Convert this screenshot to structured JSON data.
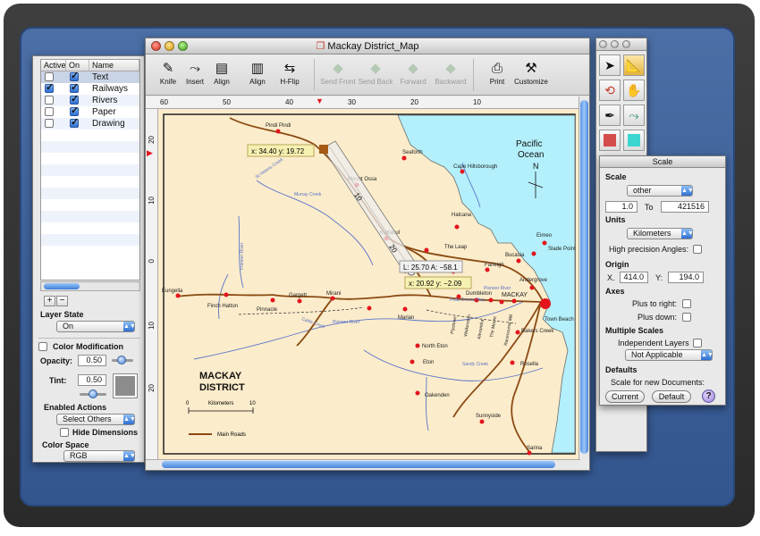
{
  "layers": {
    "columns": [
      "Active",
      "On",
      "Name"
    ],
    "rows": [
      {
        "name": "Text",
        "active": false,
        "on": true
      },
      {
        "name": "Railways",
        "active": true,
        "on": true
      },
      {
        "name": "Rivers",
        "active": false,
        "on": true
      },
      {
        "name": "Paper",
        "active": false,
        "on": true
      },
      {
        "name": "Drawing",
        "active": false,
        "on": true
      }
    ],
    "add_label": "+",
    "remove_label": "−",
    "layer_state_label": "Layer State",
    "layer_state_value": "On",
    "color_mod_label": "Color Modification",
    "opacity_label": "Opacity:",
    "opacity_value": "0.50",
    "tint_label": "Tint:",
    "tint_value": "0.50",
    "enabled_actions_label": "Enabled Actions",
    "enabled_actions_value": "Select Others",
    "hide_dimensions_label": "Hide Dimensions",
    "color_space_label": "Color Space",
    "color_space_value": "RGB"
  },
  "map_window": {
    "title": "Mackay District_Map",
    "toolbar": [
      {
        "label": "Knife",
        "icon": "knife-icon",
        "glyph": "✎",
        "enabled": true
      },
      {
        "label": "Insert",
        "icon": "insert-icon",
        "glyph": "⤳",
        "enabled": true
      },
      {
        "label": "Align",
        "icon": "align-left-icon",
        "glyph": "▤",
        "enabled": true
      },
      {
        "label": "Align",
        "icon": "align-top-icon",
        "glyph": "▥",
        "enabled": true
      },
      {
        "label": "H-Flip",
        "icon": "hflip-icon",
        "glyph": "⇆",
        "enabled": true
      },
      {
        "label": "Send Front",
        "icon": "send-front-icon",
        "glyph": "◆",
        "enabled": false
      },
      {
        "label": "Send Back",
        "icon": "send-back-icon",
        "glyph": "◆",
        "enabled": false
      },
      {
        "label": "Forward",
        "icon": "forward-icon",
        "glyph": "◆",
        "enabled": false
      },
      {
        "label": "Backward",
        "icon": "backward-icon",
        "glyph": "◆",
        "enabled": false
      },
      {
        "label": "Print",
        "icon": "print-icon",
        "glyph": "⎙",
        "enabled": true
      },
      {
        "label": "Customize",
        "icon": "customize-icon",
        "glyph": "⚒",
        "enabled": true
      }
    ],
    "hruler_ticks": [
      "60",
      "50",
      "40",
      "30",
      "20",
      "10"
    ],
    "vruler_ticks": [
      "20",
      "10",
      "0",
      "10",
      "20"
    ],
    "map": {
      "places": [
        "Pindi Pindi",
        "Seaforth",
        "Cape Hillsborough",
        "Mount Ossa",
        "Murray Creek",
        "St Helens Creek",
        "Halcana",
        "Kuttabul",
        "The Leap",
        "Bucasia",
        "Eimeo",
        "Slade Point",
        "Farleigh",
        "Andergrove",
        "Dumbleton",
        "Pioneer River",
        "MACKAY",
        "Town Beach",
        "Eungella",
        "Finch Hatton",
        "Pinnacle",
        "Gargett",
        "Mirani",
        "Marian",
        "Cattle Creek",
        "Pioneer River",
        "Eton",
        "North Eton",
        "Oakenden",
        "Sunnyside",
        "Bakers Creek",
        "Rosella",
        "Sarina",
        "Peak Downs Hwy",
        "Plystowe",
        "Walkerston",
        "Alexandra",
        "The Mount",
        "Racecourse Mill",
        "Sandy Creek",
        "Pioneer River"
      ],
      "title_line1": "MACKAY",
      "title_line2": "DISTRICT",
      "ocean_line1": "Pacific",
      "ocean_line2": "Ocean",
      "north_label": "N",
      "scale_zero": "0",
      "scale_unit": "Kilometers",
      "scale_ten": "10",
      "legend_label": "Main Roads",
      "coord1": "x: 34.40  y: 19.72",
      "measure": "L: 25.70  A: −58.1",
      "coord2": "x: 20.92  y: −2.09",
      "tape_marks": [
        "10",
        "20"
      ]
    }
  },
  "scale_palette": {
    "title": "Scale",
    "scale_label": "Scale",
    "scale_value": "other",
    "scale_from": "1.0",
    "scale_to_label": "To",
    "scale_to": "421516",
    "units_label": "Units",
    "units_value": "Kilometers",
    "high_precision_label": "High precision Angles:",
    "origin_label": "Origin",
    "origin_x_label": "X.",
    "origin_x": "414.0",
    "origin_y_label": "Y:",
    "origin_y": "194.0",
    "axes_label": "Axes",
    "plus_right_label": "Plus to right:",
    "plus_down_label": "Plus down:",
    "multiple_scales_label": "Multiple Scales",
    "independent_layers_label": "Independent Layers",
    "independent_value": "Not Applicable",
    "defaults_label": "Defaults",
    "scale_new_docs_label": "Scale for new Documents:",
    "current_button": "Current",
    "default_button": "Default",
    "help_label": "?"
  },
  "colors": {
    "paper": "#fbeccb",
    "water": "#b3f0fb",
    "road": "#8a4a12",
    "town": "#e3141c",
    "accent": "#3b7fd8"
  }
}
